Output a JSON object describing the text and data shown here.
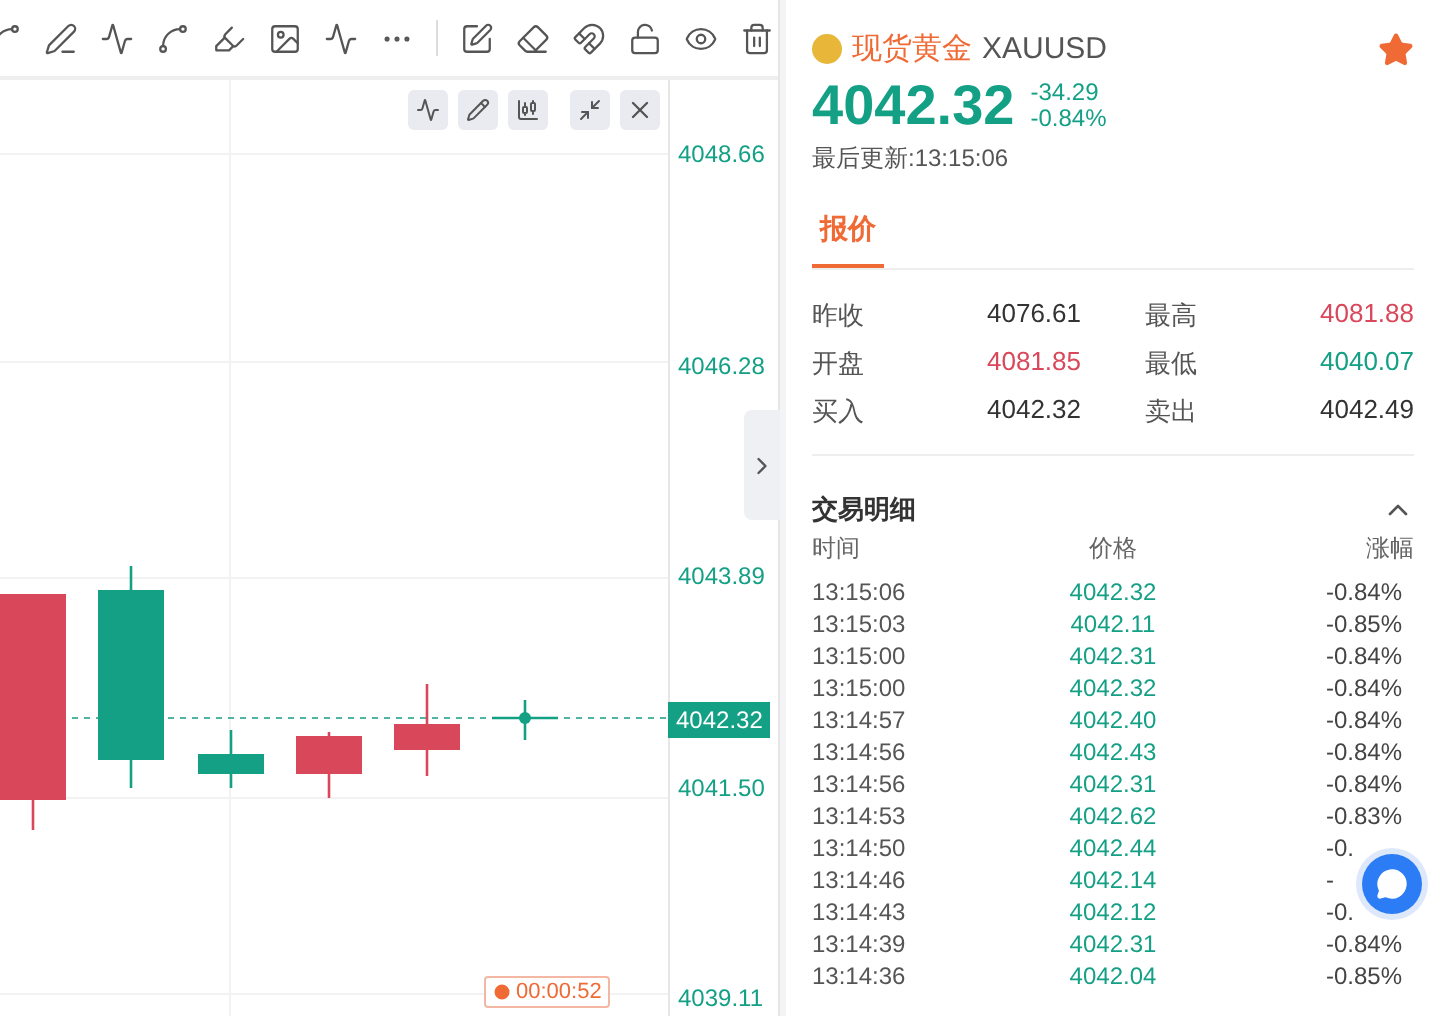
{
  "chart": {
    "price_axis": [
      "4048.66",
      "4046.28",
      "4043.89",
      "4041.50",
      "4039.11"
    ],
    "last_price": "4042.32",
    "countdown": "00:00:52"
  },
  "quote": {
    "name": "现货黄金",
    "symbol": "XAUUSD",
    "favorite": true,
    "price": "4042.32",
    "change": "-34.29",
    "change_percent": "-0.84%",
    "updated": "最后更新:13:15:06"
  },
  "tabs": [
    {
      "label": "报价",
      "selected": true
    }
  ],
  "stats": [
    {
      "label": "昨收",
      "value": "4076.61",
      "color": "#333333"
    },
    {
      "label": "最高",
      "value": "4081.88",
      "color": "#d9475a"
    },
    {
      "label": "开盘",
      "value": "4081.85",
      "color": "#d9475a"
    },
    {
      "label": "最低",
      "value": "4040.07",
      "color": "#14a085"
    },
    {
      "label": "买入",
      "value": "4042.32",
      "color": "#333333"
    },
    {
      "label": "卖出",
      "value": "4042.49",
      "color": "#333333"
    }
  ],
  "trades": {
    "title": "交易明细",
    "expanded": true,
    "columns": [
      "时间",
      "价格",
      "涨幅"
    ],
    "rows": [
      {
        "time": "13:15:06",
        "price": "4042.32",
        "change": "-0.84%"
      },
      {
        "time": "13:15:03",
        "price": "4042.11",
        "change": "-0.85%"
      },
      {
        "time": "13:15:00",
        "price": "4042.31",
        "change": "-0.84%"
      },
      {
        "time": "13:15:00",
        "price": "4042.32",
        "change": "-0.84%"
      },
      {
        "time": "13:14:57",
        "price": "4042.40",
        "change": "-0.84%"
      },
      {
        "time": "13:14:56",
        "price": "4042.43",
        "change": "-0.84%"
      },
      {
        "time": "13:14:56",
        "price": "4042.31",
        "change": "-0.84%"
      },
      {
        "time": "13:14:53",
        "price": "4042.62",
        "change": "-0.83%"
      },
      {
        "time": "13:14:50",
        "price": "4042.44",
        "change": "-0."
      },
      {
        "time": "13:14:46",
        "price": "4042.14",
        "change": "-"
      },
      {
        "time": "13:14:43",
        "price": "4042.12",
        "change": "-0."
      },
      {
        "time": "13:14:39",
        "price": "4042.31",
        "change": "-0.84%"
      },
      {
        "time": "13:14:36",
        "price": "4042.04",
        "change": "-0.85%"
      }
    ]
  }
}
